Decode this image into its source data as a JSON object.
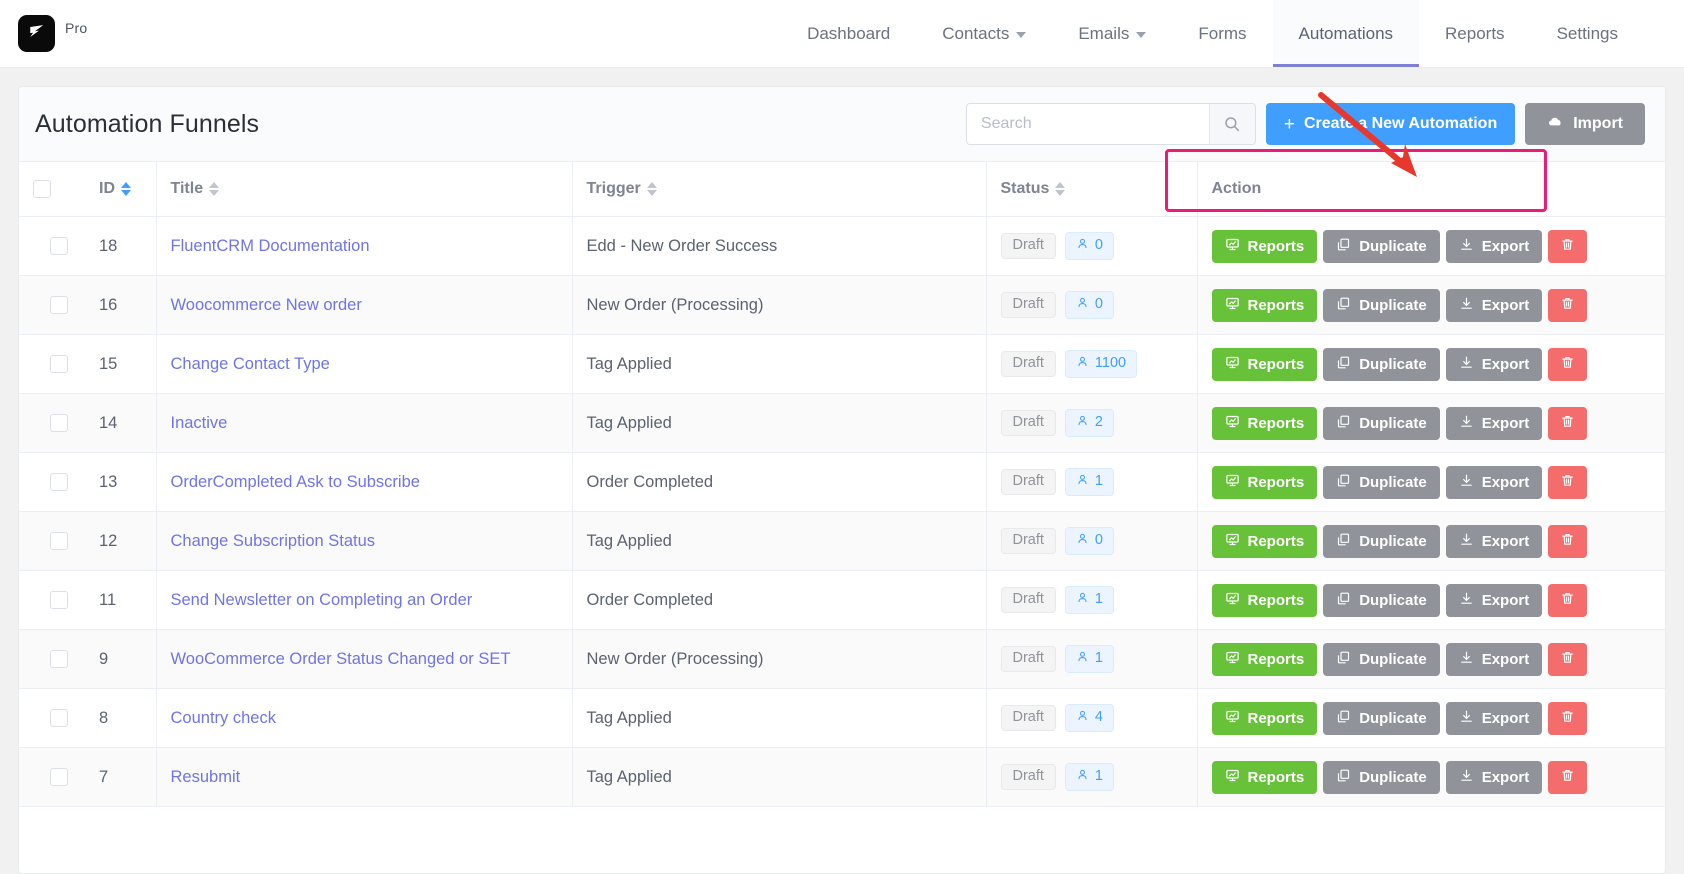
{
  "topbar": {
    "brand_label": "Pro",
    "brand_icon": "fluentcrm-logo-icon",
    "nav": [
      {
        "label": "Dashboard",
        "has_caret": false,
        "active": false
      },
      {
        "label": "Contacts",
        "has_caret": true,
        "active": false
      },
      {
        "label": "Emails",
        "has_caret": true,
        "active": false
      },
      {
        "label": "Forms",
        "has_caret": false,
        "active": false
      },
      {
        "label": "Automations",
        "has_caret": false,
        "active": true
      },
      {
        "label": "Reports",
        "has_caret": false,
        "active": false
      },
      {
        "label": "Settings",
        "has_caret": false,
        "active": false
      }
    ]
  },
  "page": {
    "title": "Automation Funnels",
    "search": {
      "value": "",
      "placeholder": "Search",
      "icon": "search-icon"
    },
    "create_button": {
      "label": "Create a New Automation",
      "icon": "plus-icon",
      "color": "#409eff"
    },
    "import_button": {
      "label": "Import",
      "icon": "cloud-upload-icon",
      "color": "#909399"
    }
  },
  "table": {
    "headers": {
      "select_all": "",
      "id": "ID",
      "title": "Title",
      "trigger": "Trigger",
      "status": "Status",
      "action": "Action"
    },
    "sort": {
      "column": "ID",
      "direction": "desc"
    },
    "action_labels": {
      "reports": "Reports",
      "duplicate": "Duplicate",
      "export": "Export",
      "delete": ""
    },
    "action_icons": {
      "reports": "chart-presentation-icon",
      "duplicate": "copy-icon",
      "export": "download-icon",
      "delete": "trash-icon"
    },
    "status_label": "Draft",
    "count_icon": "user-icon",
    "rows": [
      {
        "id": "18",
        "title": "FluentCRM Documentation",
        "trigger": "Edd - New Order Success",
        "status": "Draft",
        "count": "0"
      },
      {
        "id": "16",
        "title": "Woocommerce New order",
        "trigger": "New Order (Processing)",
        "status": "Draft",
        "count": "0"
      },
      {
        "id": "15",
        "title": "Change Contact Type",
        "trigger": "Tag Applied",
        "status": "Draft",
        "count": "1100"
      },
      {
        "id": "14",
        "title": "Inactive",
        "trigger": "Tag Applied",
        "status": "Draft",
        "count": "2"
      },
      {
        "id": "13",
        "title": "OrderCompleted Ask to Subscribe",
        "trigger": "Order Completed",
        "status": "Draft",
        "count": "1"
      },
      {
        "id": "12",
        "title": "Change Subscription Status",
        "trigger": "Tag Applied",
        "status": "Draft",
        "count": "0"
      },
      {
        "id": "11",
        "title": "Send Newsletter on Completing an Order",
        "trigger": "Order Completed",
        "status": "Draft",
        "count": "1"
      },
      {
        "id": "9",
        "title": "WooCommerce Order Status Changed or SET",
        "trigger": "New Order (Processing)",
        "status": "Draft",
        "count": "1"
      },
      {
        "id": "8",
        "title": "Country check",
        "trigger": "Tag Applied",
        "status": "Draft",
        "count": "4"
      },
      {
        "id": "7",
        "title": "Resubmit",
        "trigger": "Tag Applied",
        "status": "Draft",
        "count": "1"
      }
    ]
  },
  "annotations": {
    "highlight_box": {
      "target": "row-18-action-buttons",
      "color": "#ec1a79"
    },
    "arrow": {
      "target": "export-button-row-18",
      "color": "#e8372c"
    }
  },
  "colors": {
    "accent_blue": "#409eff",
    "link": "#6f74e8",
    "green": "#67c23a",
    "grey": "#909399",
    "red": "#f56c6c",
    "nav_active_underline": "#7f7fd5",
    "annotation_pink": "#ec1a79",
    "annotation_red": "#e8372c"
  }
}
